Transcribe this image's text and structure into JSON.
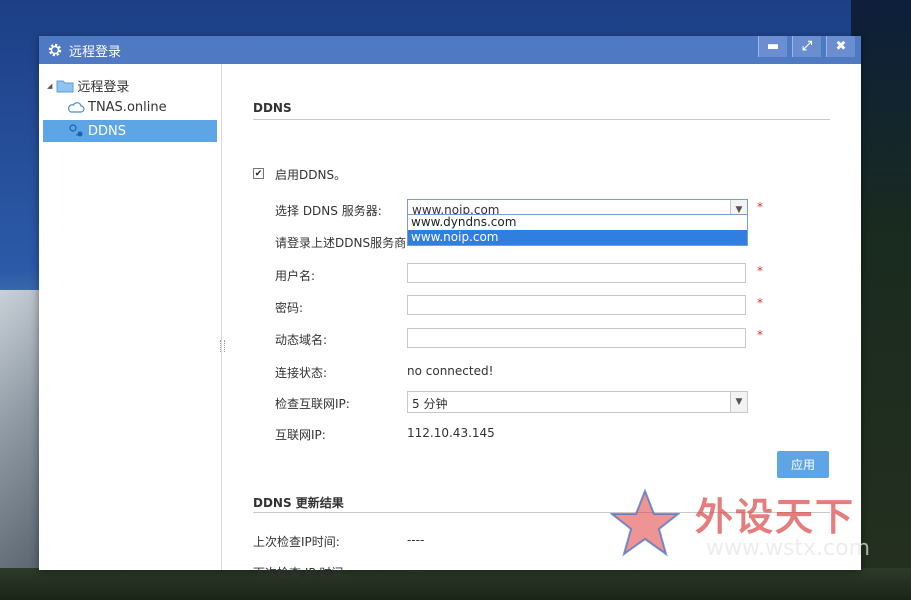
{
  "window": {
    "title": "远程登录",
    "controls": {
      "minimize": "▬",
      "maximize": "⤢",
      "close": "✖"
    }
  },
  "sidebar": {
    "root": {
      "toggle": "◢",
      "label": "远程登录"
    },
    "items": [
      {
        "label": "TNAS.online",
        "icon": "cloud-icon"
      },
      {
        "label": "DDNS",
        "icon": "network-icon",
        "selected": true
      }
    ]
  },
  "ddns": {
    "section_title": "DDNS",
    "enable_label": "启用DDNS。",
    "enabled": true,
    "server_label": "选择 DDNS 服务器:",
    "server_value": "www.noip.com",
    "server_options": [
      "www.dyndns.com",
      "www.noip.com"
    ],
    "login_hint": "请登录上述DDNS服务商",
    "username_label": "用户名:",
    "password_label": "密码:",
    "domain_label": "动态域名:",
    "status_label": "连接状态:",
    "status_value": "no connected!",
    "check_label": "检查互联网IP:",
    "check_value": "5 分钟",
    "ip_label": "互联网IP:",
    "ip_value": "112.10.43.145",
    "apply_label": "应用",
    "required_mark": "*"
  },
  "results": {
    "section_title": "DDNS 更新结果",
    "last_check_label": "上次检查IP时间:",
    "last_check_value": "----",
    "next_check_label": "下次检查 IP 时间:",
    "next_check_value": "----"
  },
  "watermark": {
    "text": "外设天下",
    "url": "www.wstx.com"
  },
  "colors": {
    "titlebar": "#4f79c3",
    "accent": "#5ea5e5",
    "required": "#e23a3a",
    "dropdown_selected": "#2f7ee0"
  }
}
